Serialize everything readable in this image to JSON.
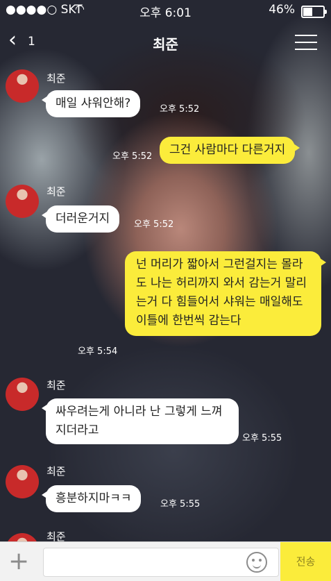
{
  "status_bar": {
    "carrier": "●●●●○ SKT",
    "time": "오후 6:01",
    "battery_pct": "46%"
  },
  "nav": {
    "back_count": "1",
    "title": "최준"
  },
  "messages": [
    {
      "sender": "최준",
      "text": "매일 샤워안해?",
      "time": "오후 5:52"
    },
    {
      "text": "그건 사람마다 다른거지",
      "time": "오후 5:52"
    },
    {
      "sender": "최준",
      "text": "더러운거지",
      "time": "오후 5:52"
    },
    {
      "text": "넌 머리가 짧아서 그런걸지는 몰라도 나는 허리까지 와서 감는거 말리는거 다 힘들어서 샤워는 매일해도 이틀에 한번씩 감는다",
      "time": "오후 5:54"
    },
    {
      "sender": "최준",
      "text": "싸우려는게 아니라 난 그렇게 느껴지더라고",
      "time": "오후 5:55"
    },
    {
      "sender": "최준",
      "text": "흥분하지마ㅋㅋ",
      "time": "오후 5:55"
    },
    {
      "sender": "최준"
    }
  ],
  "input": {
    "placeholder": "",
    "send_label": "전송"
  },
  "colors": {
    "my_bubble": "#fbec3b",
    "their_bubble": "#ffffff",
    "send_button": "#fbec3b"
  }
}
